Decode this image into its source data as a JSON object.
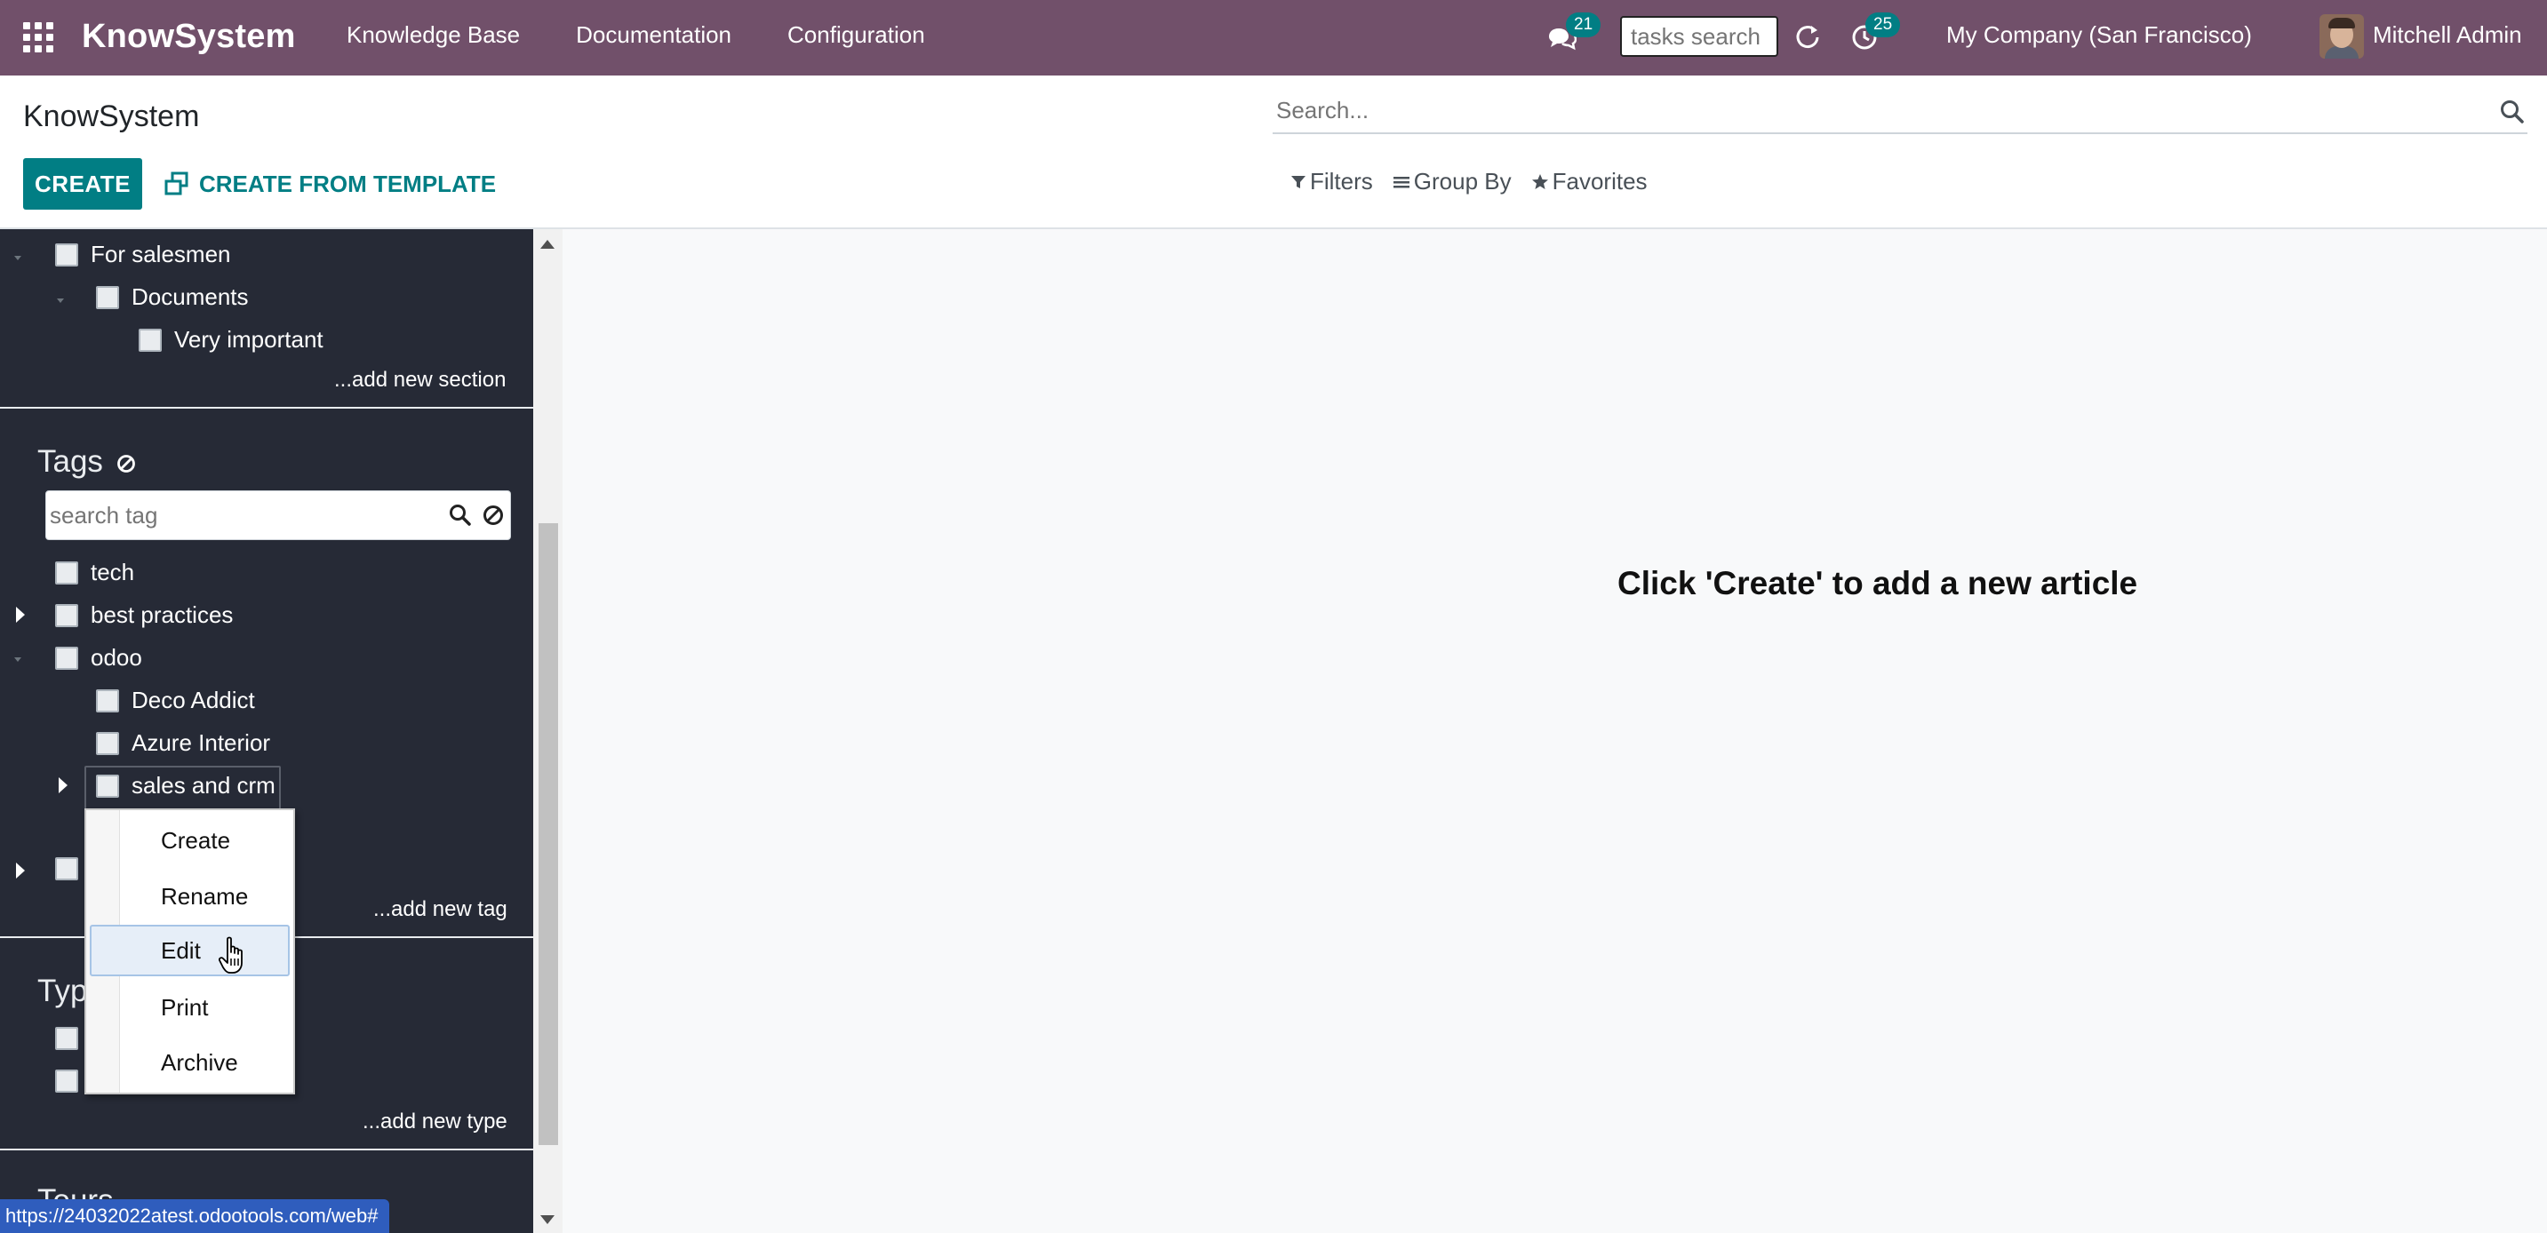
{
  "navbar": {
    "brand": "KnowSystem",
    "menu": [
      "Knowledge Base",
      "Documentation",
      "Configuration"
    ],
    "messages_count": "21",
    "tasks_search_placeholder": "tasks search",
    "activities_count": "25",
    "company": "My Company (San Francisco)",
    "user": "Mitchell Admin"
  },
  "control_panel": {
    "title": "KnowSystem",
    "search_placeholder": "Search...",
    "create_label": "CREATE",
    "create_template_label": "CREATE FROM TEMPLATE",
    "filters_label": "Filters",
    "group_by_label": "Group By",
    "favorites_label": "Favorites"
  },
  "sidebar": {
    "sections_tree": [
      {
        "label": "For salesmen"
      },
      {
        "label": "Documents"
      },
      {
        "label": "Very important"
      }
    ],
    "add_section_label": "...add new section",
    "tags_title": "Tags",
    "tag_search_placeholder": "search tag",
    "tags_tree": [
      {
        "label": "tech"
      },
      {
        "label": "best practices"
      },
      {
        "label": "odoo"
      },
      {
        "label": "Deco Addict"
      },
      {
        "label": "Azure Interior"
      },
      {
        "label": "sales and crm"
      }
    ],
    "add_tag_label": "...add new tag",
    "types_title": "Types",
    "types_title_visible": "Typ",
    "add_type_label": "...add new type",
    "tours_title_partial": "Tours"
  },
  "context_menu": {
    "items": [
      "Create",
      "Rename",
      "Edit",
      "Print",
      "Archive"
    ],
    "hovered": "Edit"
  },
  "content": {
    "empty_message": "Click 'Create' to add a new article"
  },
  "status_bar": {
    "url": "https://24032022atest.odootools.com/web#"
  },
  "colors": {
    "navbar": "#71506a",
    "primary": "#017e84",
    "sidebar": "#262a36"
  }
}
